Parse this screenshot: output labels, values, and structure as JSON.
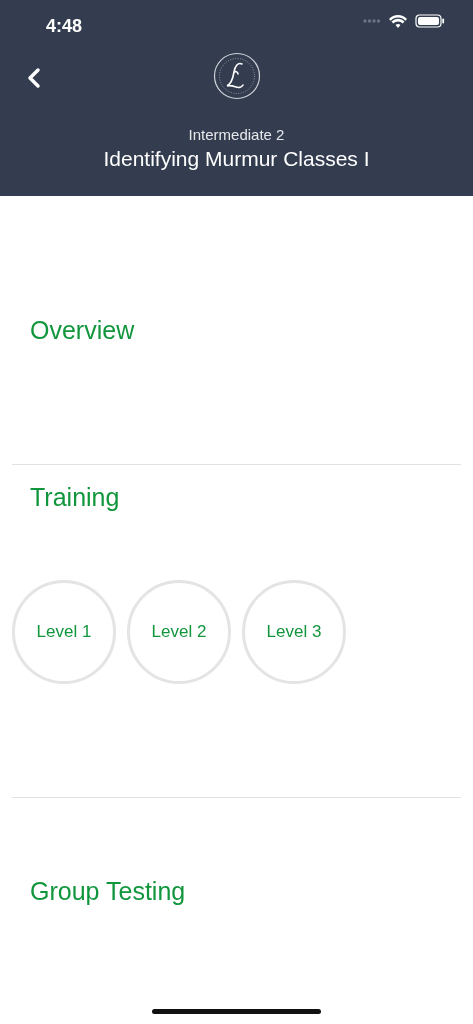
{
  "status_bar": {
    "time": "4:48"
  },
  "header": {
    "subtitle": "Intermediate 2",
    "title": "Identifying Murmur Classes I"
  },
  "sections": [
    {
      "title": "Overview"
    },
    {
      "title": "Training",
      "levels": [
        {
          "label": "Level 1"
        },
        {
          "label": "Level 2"
        },
        {
          "label": "Level 3"
        }
      ]
    },
    {
      "title": "Group Testing"
    }
  ]
}
